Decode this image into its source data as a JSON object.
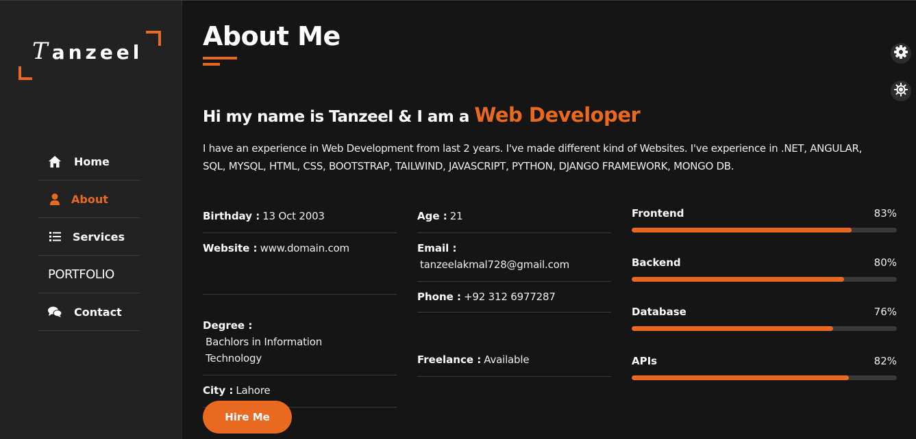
{
  "sidebar": {
    "logo": {
      "first": "T",
      "rest": "anzeel"
    },
    "nav": [
      {
        "label": "Home",
        "icon": "home-icon"
      },
      {
        "label": "About",
        "icon": "user-icon",
        "active": true
      },
      {
        "label": "Services",
        "icon": "list-icon"
      },
      {
        "label": "PORTFOLIO"
      },
      {
        "label": "Contact",
        "icon": "chat-icon"
      }
    ]
  },
  "main": {
    "title": "About Me",
    "intro_prefix": "Hi my name is Tanzeel & I am a ",
    "intro_role": "Web Developer",
    "description": "I have an experience in Web Development from last 2 years. I've made different kind of Websites. I've experience in .NET, ANGULAR, SQL, MYSQL, HTML, CSS, BOOTSTRAP, TAILWIND, JAVASCRIPT, PYTHON, DJANGO FRAMEWORK, MONGO DB.",
    "info_left": [
      {
        "key": "Birthday :",
        "value": "13 Oct 2003"
      },
      {
        "key": "Website :",
        "value": "www.domain.com"
      },
      {
        "key": "Degree :",
        "value": "Bachlors in Information Technology"
      },
      {
        "key": "City :",
        "value": "Lahore"
      }
    ],
    "info_right": [
      {
        "key": "Age :",
        "value": "21"
      },
      {
        "key": "Email :",
        "value": "tanzeelakmal728@gmail.com"
      },
      {
        "key": "Phone :",
        "value": "+92 312 6977287"
      },
      {
        "key": "Freelance :",
        "value": "Available"
      }
    ],
    "skills": [
      {
        "name": "Frontend",
        "percent_label": "83%",
        "percent": 83
      },
      {
        "name": "Backend",
        "percent_label": "80%",
        "percent": 80
      },
      {
        "name": "Database",
        "percent_label": "76%",
        "percent": 76
      },
      {
        "name": "APIs",
        "percent_label": "82%",
        "percent": 82
      }
    ],
    "hire_label": "Hire Me"
  },
  "colors": {
    "accent": "#e8691f",
    "background": "#151515",
    "sidebar": "#222222"
  },
  "floating_buttons": [
    {
      "icon": "gear-icon"
    },
    {
      "icon": "sun-icon"
    }
  ]
}
